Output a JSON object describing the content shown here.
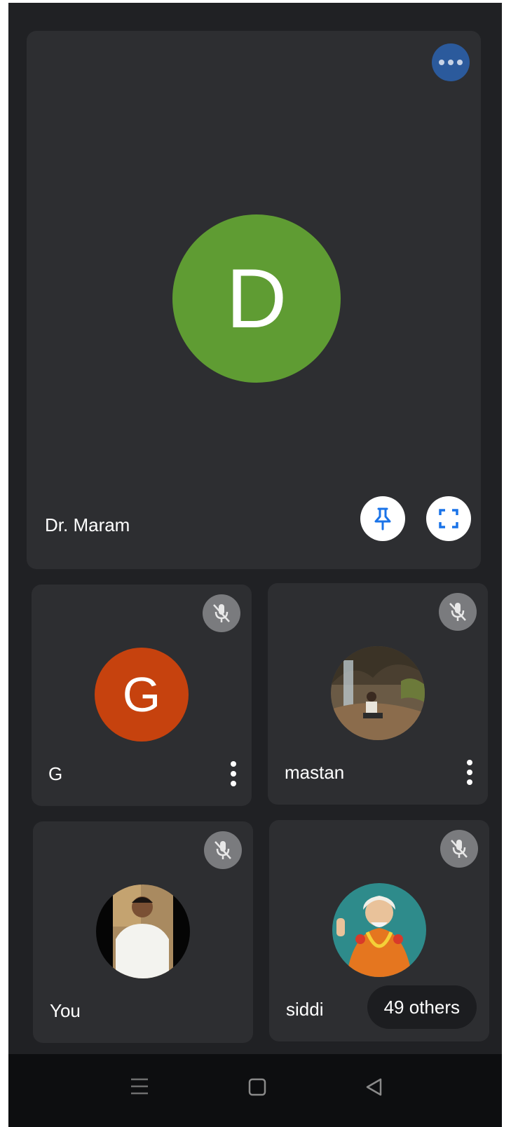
{
  "main_participant": {
    "name": "Dr. Maram",
    "initial": "D",
    "avatar_color": "#5f9c33",
    "menu_icon": "more-horiz-icon",
    "pin_icon": "pin-icon",
    "fullscreen_icon": "fullscreen-icon"
  },
  "participants": [
    {
      "name": "G",
      "initial": "G",
      "avatar_color": "#c6420e",
      "muted": true,
      "has_menu": true
    },
    {
      "name": "mastan",
      "avatar": "photo",
      "muted": true,
      "has_menu": true
    },
    {
      "name": "You",
      "avatar": "photo",
      "muted": true,
      "has_menu": false
    },
    {
      "name": "siddi",
      "avatar": "photo",
      "muted": true,
      "has_menu": false
    }
  ],
  "others_label": "49 others",
  "nav_bar": [
    "menu-icon",
    "home-icon",
    "back-icon"
  ],
  "colors": {
    "background": "#202124",
    "tile": "#2d2e31",
    "accent_blue": "#1a73e8",
    "menu_button": "#2b5a9c"
  }
}
